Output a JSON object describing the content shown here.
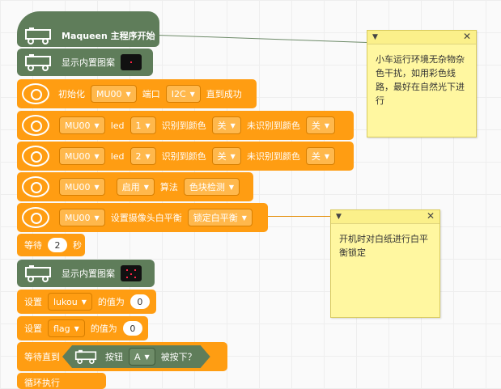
{
  "blocks": {
    "main_hat": "Maqueen 主程序开始",
    "show_image_1": "显示内置图案",
    "init": {
      "label": "初始化",
      "device": "MU00",
      "port_label": "端口",
      "port": "I2C",
      "tail": "直到成功"
    },
    "led1": {
      "device": "MU00",
      "led_label": "led",
      "led_num": "1",
      "detected_label": "识别到颜色",
      "detected_color": "关",
      "undetected_label": "未识别到颜色",
      "undetected_color": "关"
    },
    "led2": {
      "device": "MU00",
      "led_label": "led",
      "led_num": "2",
      "detected_label": "识别到颜色",
      "detected_color": "关",
      "undetected_label": "未识别到颜色",
      "undetected_color": "关"
    },
    "algo": {
      "device": "MU00",
      "state": "启用",
      "algo_label": "算法",
      "algo": "色块检测"
    },
    "wb": {
      "device": "MU00",
      "label": "设置摄像头白平衡",
      "mode": "锁定白平衡"
    },
    "wait": {
      "label": "等待",
      "value": "2",
      "unit": "秒"
    },
    "show_image_2": "显示内置图案",
    "set_lukou": {
      "label": "设置",
      "var": "lukou",
      "tail": "的值为",
      "value": "0"
    },
    "set_flag": {
      "label": "设置",
      "var": "flag",
      "tail": "的值为",
      "value": "0"
    },
    "wait_until": {
      "label": "等待直到",
      "button_label": "按钮",
      "button": "A",
      "tail": "被按下？"
    },
    "partial": "循环执行"
  },
  "notes": [
    {
      "text": "小车运行环境无杂物杂色干扰，如用彩色线路，最好在自然光下进行"
    },
    {
      "text": "开机时对白纸进行白平衡锁定"
    }
  ],
  "colors": {
    "motion": "#5f7d5a",
    "mu": "#ff9d12",
    "note": "#fff7a0"
  }
}
